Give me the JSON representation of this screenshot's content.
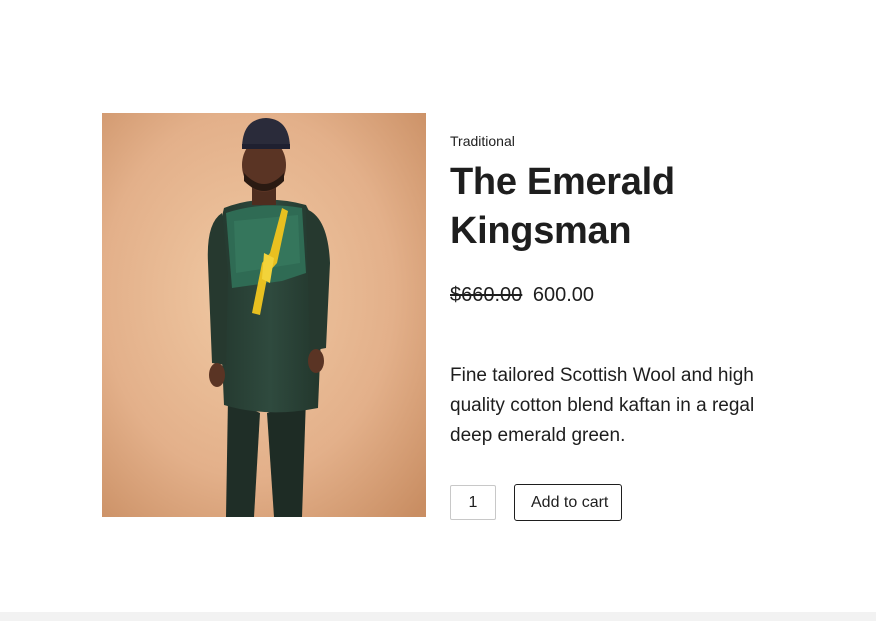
{
  "product": {
    "category": "Traditional",
    "title_line1": "The Emerald",
    "title_line2": "Kingsman",
    "price_old": "$660.00",
    "price_new": "600.00",
    "description": "Fine tailored Scottish Wool and high quality cotton blend kaftan in a regal deep emerald green.",
    "image_alt": "The Emerald Kingsman"
  },
  "cart": {
    "quantity": "1",
    "add_to_cart_label": "Add to cart"
  },
  "colors": {
    "text": "#1e1e1e",
    "background": "#ffffff",
    "image_backdrop": "#e3b38a",
    "garment": "#2b4438",
    "embroidery": "#2e6a52",
    "accent_yellow": "#e8c020"
  }
}
